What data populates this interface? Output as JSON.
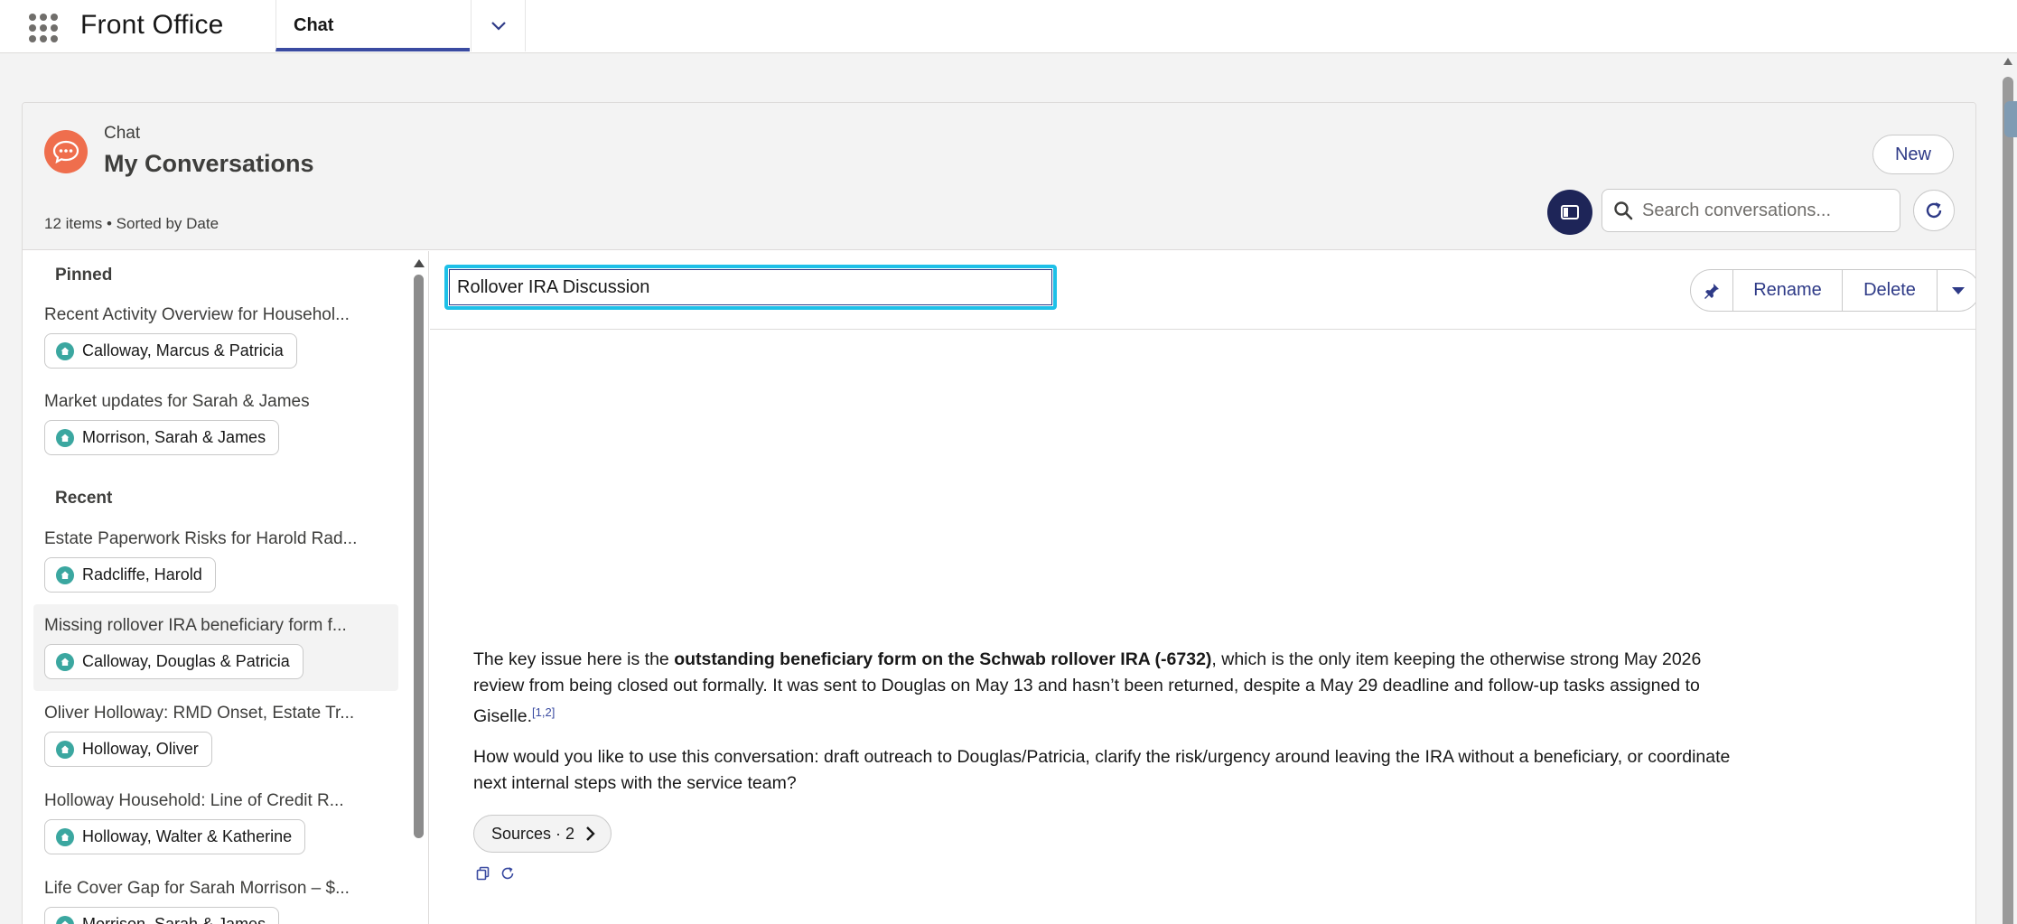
{
  "app": {
    "name": "Front Office"
  },
  "tabs": [
    {
      "label": "Chat",
      "active": true
    }
  ],
  "header": {
    "eyebrow": "Chat",
    "title": "My Conversations",
    "meta": "12 items • Sorted by Date",
    "new_label": "New",
    "search_placeholder": "Search conversations..."
  },
  "sidebar": {
    "pinned_label": "Pinned",
    "recent_label": "Recent",
    "pinned": [
      {
        "title": "Recent Activity Overview for Househol...",
        "household": "Calloway, Marcus & Patricia"
      },
      {
        "title": "Market updates for Sarah & James",
        "household": "Morrison, Sarah & James"
      }
    ],
    "recent": [
      {
        "title": "Estate Paperwork Risks for Harold Rad...",
        "household": "Radcliffe, Harold"
      },
      {
        "title": "Missing rollover IRA beneficiary form f...",
        "household": "Calloway, Douglas & Patricia",
        "selected": true
      },
      {
        "title": "Oliver Holloway: RMD Onset, Estate Tr...",
        "household": "Holloway, Oliver"
      },
      {
        "title": "Holloway Household: Line of Credit R...",
        "household": "Holloway, Walter & Katherine"
      },
      {
        "title": "Life Cover Gap for Sarah Morrison – $...",
        "household": "Morrison, Sarah & James"
      }
    ]
  },
  "conversation": {
    "title_value": "Rollover IRA Discussion",
    "rename_label": "Rename",
    "delete_label": "Delete",
    "message": {
      "p1_pre": "The key issue here is the ",
      "p1_bold": "outstanding beneficiary form on the Schwab rollover IRA (-6732)",
      "p1_post": ", which is the only item keeping the otherwise strong May 2026 review from being closed out formally. It was sent to Douglas on May 13 and hasn’t been returned, despite a May 29 deadline and follow-up tasks assigned to Giselle.",
      "p1_cite": "[1,2]",
      "p2": "How would you like to use this conversation: draft outreach to Douglas/Patricia, clarify the risk/urgency around leaving the IRA without a beneficiary, or coordinate next internal steps with the service team?"
    },
    "sources_label": "Sources · 2"
  },
  "colors": {
    "accent": "#2e3a87",
    "focus": "#1ec0e8",
    "chat_icon": "#ef6e4d",
    "household_icon": "#3ba7a0"
  },
  "icons": [
    "app-launcher-icon",
    "chevron-down-icon",
    "chat-icon",
    "panel-toggle-icon",
    "search-icon",
    "refresh-icon",
    "pin-icon",
    "household-icon",
    "chevron-right-icon",
    "copy-icon",
    "regenerate-icon"
  ]
}
